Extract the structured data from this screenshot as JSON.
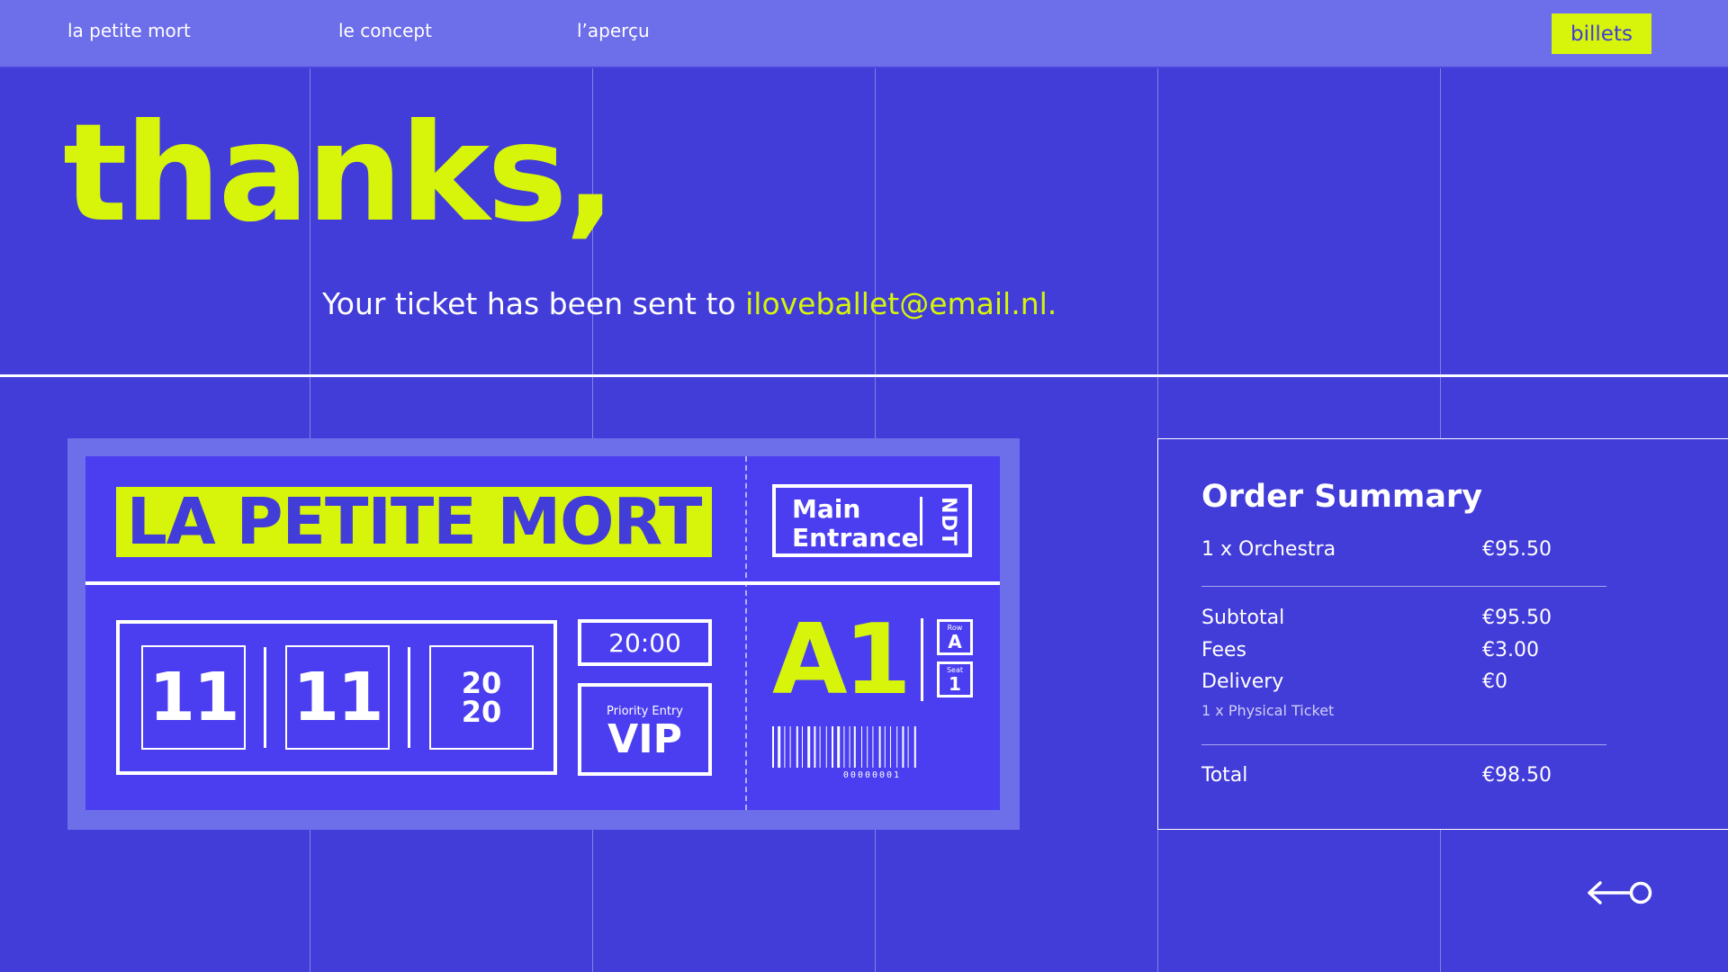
{
  "nav": {
    "links": [
      "la petite mort",
      "le concept",
      "l’aperçu"
    ],
    "cta": "billets"
  },
  "hero": {
    "heading": "thanks,",
    "message": "Your ticket has been sent to",
    "email": "iloveballet@email.nl."
  },
  "ticket": {
    "title": "LA PETITE MORT",
    "entrance": [
      "Main",
      "Entrance"
    ],
    "organizer": "NDT",
    "day": "11",
    "month": "11",
    "year": [
      "20",
      "20"
    ],
    "time": "20:00",
    "priority_label": "Priority Entry",
    "tier": "VIP",
    "seat_code": "A1",
    "row_label": "Row",
    "row_value": "A",
    "seat_label": "Seat",
    "seat_value": "1",
    "barcode_number": "00000001"
  },
  "summary": {
    "title": "Order Summary",
    "line_item": {
      "label": "1 x Orchestra",
      "amount": "€95.50"
    },
    "subtotal": {
      "label": "Subtotal",
      "amount": "€95.50"
    },
    "fees": {
      "label": "Fees",
      "amount": "€3.00"
    },
    "delivery": {
      "label": "Delivery",
      "amount": "€0"
    },
    "delivery_note": "1 x Physical Ticket",
    "total": {
      "label": "Total",
      "amount": "€98.50"
    }
  },
  "colors": {
    "background": "#423cd8",
    "nav": "#6d6ee9",
    "accent": "#d6f50b",
    "ticket": "#4a3ef0"
  },
  "icons": {
    "back": "back-arrow-icon"
  }
}
